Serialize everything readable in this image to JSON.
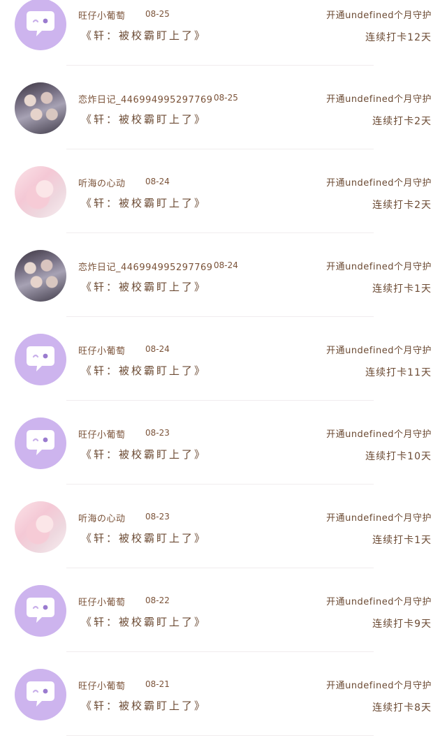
{
  "records": [
    {
      "avatar": "default-chat-icon",
      "name": "旺仔小葡萄",
      "date": "08-25",
      "book": "《轩：被校霸盯上了》",
      "status": "开通undefined个月守护",
      "streak": "连续打卡12天"
    },
    {
      "avatar": "group-photo",
      "name": "恋炸日记_446994995297769",
      "date": "08-25",
      "book": "《轩：被校霸盯上了》",
      "status": "开通undefined个月守护",
      "streak": "连续打卡2天"
    },
    {
      "avatar": "anime-girl-photo",
      "name": "听海の心动",
      "date": "08-24",
      "book": "《轩：被校霸盯上了》",
      "status": "开通undefined个月守护",
      "streak": "连续打卡2天"
    },
    {
      "avatar": "group-photo",
      "name": "恋炸日记_446994995297769",
      "date": "08-24",
      "book": "《轩：被校霸盯上了》",
      "status": "开通undefined个月守护",
      "streak": "连续打卡1天"
    },
    {
      "avatar": "default-chat-icon",
      "name": "旺仔小葡萄",
      "date": "08-24",
      "book": "《轩：被校霸盯上了》",
      "status": "开通undefined个月守护",
      "streak": "连续打卡11天"
    },
    {
      "avatar": "default-chat-icon",
      "name": "旺仔小葡萄",
      "date": "08-23",
      "book": "《轩：被校霸盯上了》",
      "status": "开通undefined个月守护",
      "streak": "连续打卡10天"
    },
    {
      "avatar": "anime-girl-photo",
      "name": "听海の心动",
      "date": "08-23",
      "book": "《轩：被校霸盯上了》",
      "status": "开通undefined个月守护",
      "streak": "连续打卡1天"
    },
    {
      "avatar": "default-chat-icon",
      "name": "旺仔小葡萄",
      "date": "08-22",
      "book": "《轩：被校霸盯上了》",
      "status": "开通undefined个月守护",
      "streak": "连续打卡9天"
    },
    {
      "avatar": "default-chat-icon",
      "name": "旺仔小葡萄",
      "date": "08-21",
      "book": "《轩：被校霸盯上了》",
      "status": "开通undefined个月守护",
      "streak": "连续打卡8天"
    }
  ]
}
